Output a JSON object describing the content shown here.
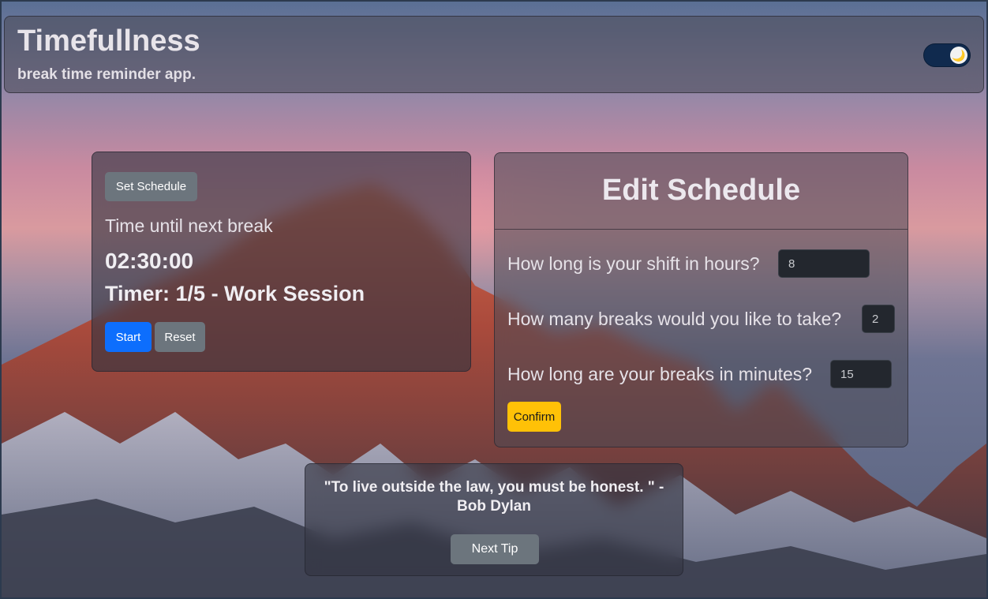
{
  "header": {
    "title": "Timefullness",
    "subtitle": "break time reminder app.",
    "theme_toggle_icon": "moon-icon",
    "theme_toggle_glyph": "🌙"
  },
  "timer": {
    "set_schedule_label": "Set Schedule",
    "until_label": "Time until next break",
    "countdown": "02:30:00",
    "session": "Timer: 1/5 - Work Session",
    "start_label": "Start",
    "reset_label": "Reset"
  },
  "edit_schedule": {
    "title": "Edit Schedule",
    "shift_hours_label": "How long is your shift in hours?",
    "shift_hours_value": "8",
    "breaks_count_label": "How many breaks would you like to take?",
    "breaks_count_value": "2",
    "break_minutes_label": "How long are your breaks in minutes?",
    "break_minutes_value": "15",
    "confirm_label": "Confirm"
  },
  "tip": {
    "quote": "\"To live outside the law, you must be honest. \" - Bob Dylan",
    "next_label": "Next Tip"
  },
  "colors": {
    "primary": "#0d6efd",
    "secondary": "#6c757d",
    "warning": "#ffc107",
    "toggle": "#102a4e"
  }
}
